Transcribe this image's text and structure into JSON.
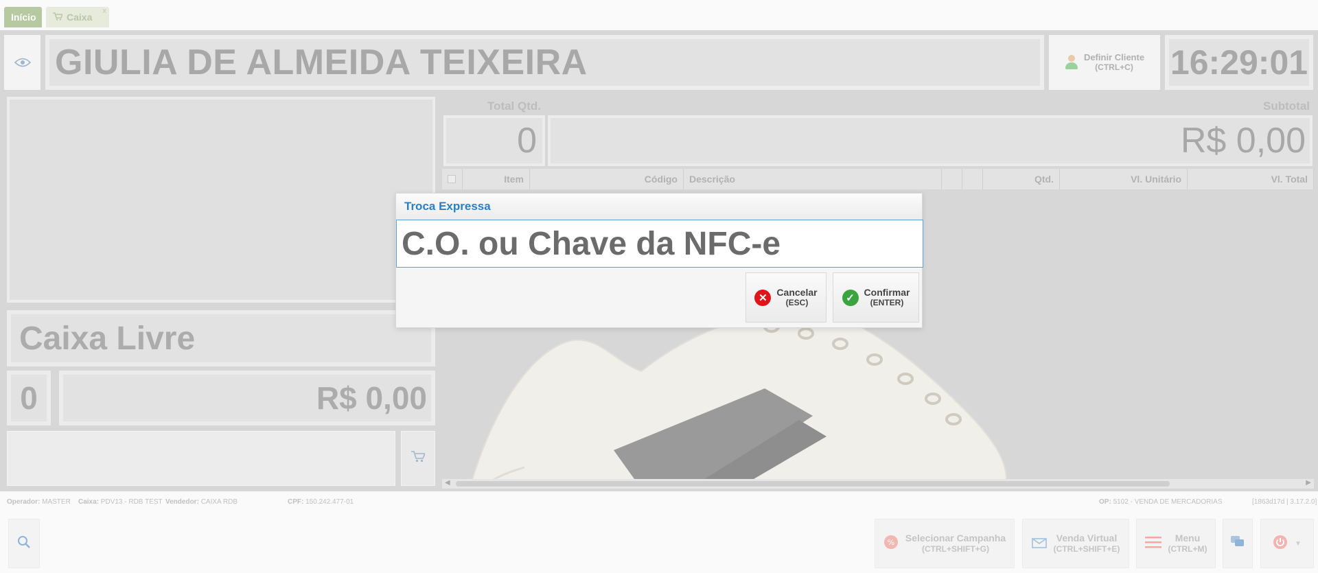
{
  "tabs": [
    {
      "label": "Início",
      "close": ""
    },
    {
      "label": "Caixa",
      "close": "x"
    }
  ],
  "header": {
    "customer_name": "GIULIA DE ALMEIDA TEIXEIRA",
    "define_client_label": "Definir Cliente",
    "define_client_shortcut": "(CTRL+C)",
    "clock": "16:29:01"
  },
  "left": {
    "status": "Caixa Livre",
    "qty": "0",
    "total": "R$ 0,00"
  },
  "totals": {
    "total_qtd_label": "Total Qtd.",
    "total_qtd": "0",
    "subtotal_label": "Subtotal",
    "subtotal": "R$ 0,00"
  },
  "grid": {
    "columns": [
      "Item",
      "Código",
      "Descrição",
      "",
      "",
      "Qtd.",
      "Vl. Unitário",
      "Vl. Total"
    ]
  },
  "info": {
    "operador_label": "Operador:",
    "operador": "MASTER",
    "caixa_label": "Caixa:",
    "caixa": "PDV13 - RDB TEST",
    "vendedor_label": "Vendedor:",
    "vendedor": "CAIXA RDB",
    "cpf_label": "CPF:",
    "cpf": "150.242.477-01",
    "op_label": "OP:",
    "op": "5102 - VENDA DE MERCADORIAS",
    "version": "[1863d17d | 3.17.2.0]"
  },
  "actions": {
    "campanha_label": "Selecionar Campanha",
    "campanha_shortcut": "(CTRL+SHIFT+G)",
    "virtual_label": "Venda Virtual",
    "virtual_shortcut": "(CTRL+SHIFT+E)",
    "menu_label": "Menu",
    "menu_shortcut": "(CTRL+M)"
  },
  "modal": {
    "title": "Troca Expressa",
    "input_placeholder": "C.O. ou Chave da NFC-e",
    "cancel_label": "Cancelar",
    "cancel_shortcut": "(ESC)",
    "confirm_label": "Confirmar",
    "confirm_shortcut": "(ENTER)"
  },
  "colors": {
    "modal_title": "#2a7fc5",
    "cancel_icon": "#e1141c",
    "confirm_icon": "#3ba43f",
    "input_border": "#58a3d9"
  }
}
